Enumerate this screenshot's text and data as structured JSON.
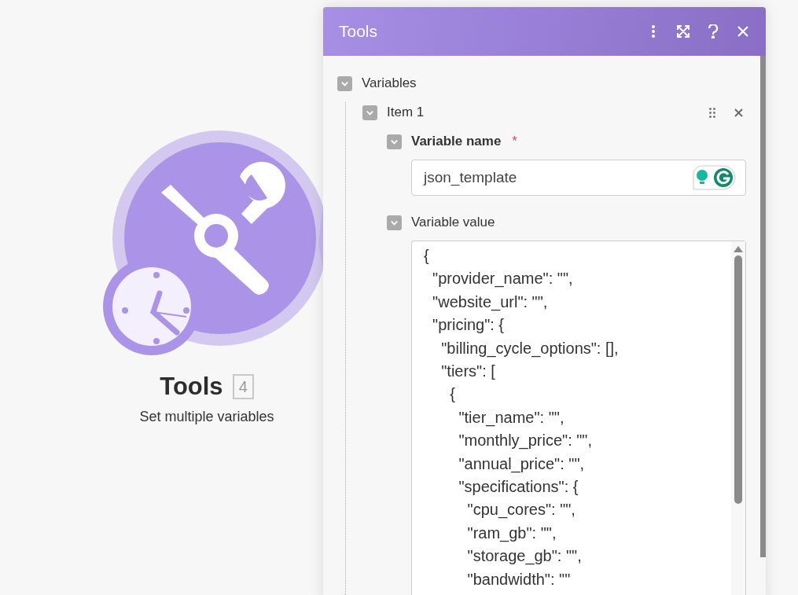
{
  "module": {
    "title": "Tools",
    "count": "4",
    "subtitle": "Set multiple variables"
  },
  "panel": {
    "title": "Tools",
    "section": {
      "label": "Variables",
      "expanded": true,
      "items": [
        {
          "label": "Item 1",
          "expanded": true,
          "fields": [
            {
              "kind": "text",
              "label": "Variable name",
              "required": true,
              "required_mark": "*",
              "expanded": true,
              "value": "json_template"
            },
            {
              "kind": "textarea",
              "label": "Variable value",
              "required": false,
              "expanded": true,
              "lines": [
                "{",
                "  \"provider_name\": \"\",",
                "  \"website_url\": \"\",",
                "  \"pricing\": {",
                "    \"billing_cycle_options\": [],",
                "    \"tiers\": [",
                "      {",
                "        \"tier_name\": \"\",",
                "        \"monthly_price\": \"\",",
                "        \"annual_price\": \"\",",
                "        \"specifications\": {",
                "          \"cpu_cores\": \"\",",
                "          \"ram_gb\": \"\",",
                "          \"storage_gb\": \"\",",
                "          \"bandwidth\": \"\""
              ]
            }
          ]
        }
      ]
    }
  }
}
